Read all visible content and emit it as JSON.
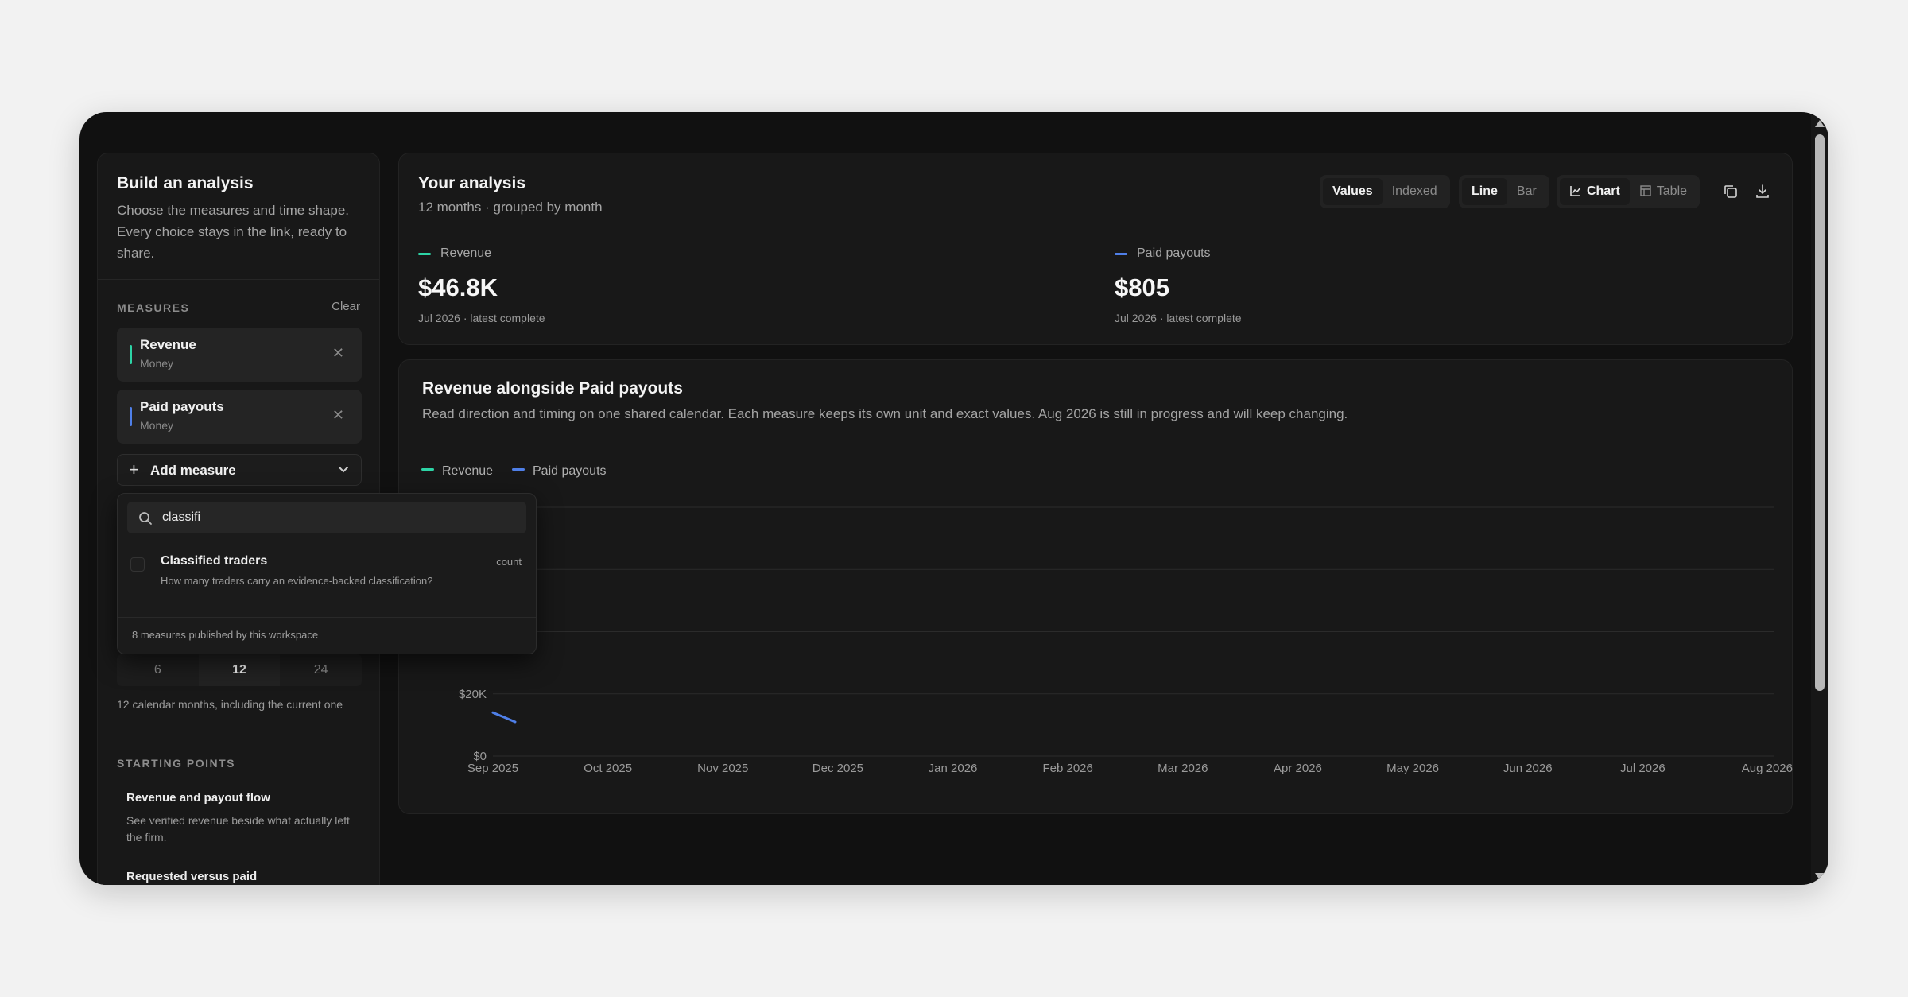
{
  "sidebar": {
    "title": "Build an analysis",
    "description": "Choose the measures and time shape. Every choice stays in the link, ready to share.",
    "measures_label": "MEASURES",
    "clear_label": "Clear",
    "measures": [
      {
        "name": "Revenue",
        "unit": "Money",
        "color": "#2dd4a6"
      },
      {
        "name": "Paid payouts",
        "unit": "Money",
        "color": "#4f7fe8"
      }
    ],
    "remove_icon": "close-icon",
    "add_measure_label": "Add measure",
    "period_options": [
      "6",
      "12",
      "24"
    ],
    "period_selected": "12",
    "period_note": "12 calendar months, including the current one",
    "starting_points_label": "STARTING POINTS",
    "starting_points": [
      {
        "title": "Revenue and payout flow",
        "desc": "See verified revenue beside what actually left the firm."
      },
      {
        "title": "Requested versus paid",
        "desc": ""
      }
    ]
  },
  "dropdown": {
    "search_value": "classifi",
    "option": {
      "title": "Classified traders",
      "desc": "How many traders carry an evidence-backed classification?",
      "kind": "count"
    },
    "footer": "8 measures published by this workspace"
  },
  "header": {
    "title": "Your analysis",
    "subtitle": "12 months · grouped by month",
    "mode": {
      "options": [
        "Values",
        "Indexed"
      ],
      "selected": "Values"
    },
    "shape": {
      "options": [
        "Line",
        "Bar"
      ],
      "selected": "Line"
    },
    "view": {
      "options": [
        "Chart",
        "Table"
      ],
      "selected": "Chart"
    },
    "copy_icon": "copy-icon",
    "download_icon": "download-icon"
  },
  "kpis": [
    {
      "label": "Revenue",
      "value": "$46.8K",
      "note": "Jul 2026 · latest complete",
      "color": "#2dd4a6"
    },
    {
      "label": "Paid payouts",
      "value": "$805",
      "note": "Jul 2026 · latest complete",
      "color": "#4f7fe8"
    }
  ],
  "chart_panel": {
    "title": "Revenue alongside Paid payouts",
    "description": "Read direction and timing on one shared calendar. Each measure keeps its own unit and exact values. Aug 2026 is still in progress and will keep changing."
  },
  "chart_data": {
    "type": "line",
    "x": [
      "Sep 2025",
      "Oct 2025",
      "Nov 2025",
      "Dec 2025",
      "Jan 2026",
      "Feb 2026",
      "Mar 2026",
      "Apr 2026",
      "May 2026",
      "Jun 2026",
      "Jul 2026",
      "Aug 2026"
    ],
    "y_ticks": [
      "$0",
      "$20K"
    ],
    "ylim": [
      0,
      80000
    ],
    "grid": true,
    "legend_position": "top-left",
    "series": [
      {
        "name": "Revenue",
        "color": "#2dd4a6",
        "values": []
      },
      {
        "name": "Paid payouts",
        "color": "#4f7fe8",
        "values": [
          14000,
          11000
        ]
      }
    ]
  }
}
